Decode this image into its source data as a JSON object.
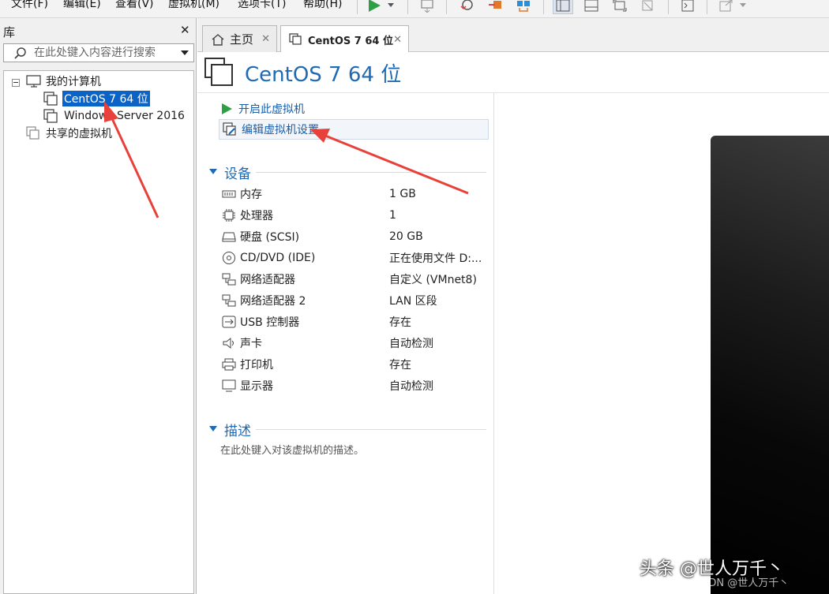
{
  "menu": [
    "文件(F)",
    "编辑(E)",
    "查看(V)",
    "虚拟机(M)",
    "选项卡(T)",
    "帮助(H)"
  ],
  "library": {
    "title": "库",
    "search_placeholder": "在此处键入内容进行搜索",
    "tree": {
      "root": "我的计算机",
      "vms": [
        "CentOS 7 64 位",
        "Windows Server 2016"
      ],
      "shared": "共享的虚拟机"
    }
  },
  "tabs": [
    {
      "label": "主页",
      "active": false
    },
    {
      "label": "CentOS 7 64 位",
      "active": true
    }
  ],
  "vm": {
    "title": "CentOS 7 64 位",
    "actions": [
      "开启此虚拟机",
      "编辑虚拟机设置"
    ],
    "devices_heading": "设备",
    "devices": [
      {
        "name": "内存",
        "value": "1 GB",
        "icon": "memory-icon"
      },
      {
        "name": "处理器",
        "value": "1",
        "icon": "cpu-icon"
      },
      {
        "name": "硬盘 (SCSI)",
        "value": "20 GB",
        "icon": "hard-disk-icon"
      },
      {
        "name": "CD/DVD (IDE)",
        "value": "正在使用文件 D:...",
        "icon": "cd-dvd-icon"
      },
      {
        "name": "网络适配器",
        "value": "自定义 (VMnet8)",
        "icon": "network-adapter-icon"
      },
      {
        "name": "网络适配器 2",
        "value": "LAN 区段",
        "icon": "network-adapter-icon"
      },
      {
        "name": "USB 控制器",
        "value": "存在",
        "icon": "usb-controller-icon"
      },
      {
        "name": "声卡",
        "value": "自动检测",
        "icon": "sound-card-icon"
      },
      {
        "name": "打印机",
        "value": "存在",
        "icon": "printer-icon"
      },
      {
        "name": "显示器",
        "value": "自动检测",
        "icon": "display-icon"
      }
    ],
    "description_heading": "描述",
    "description_placeholder": "在此处键入对该虚拟机的描述。"
  },
  "watermark": {
    "text": "头条 @世人万千丶",
    "sub": "CSDN @世人万千丶"
  },
  "colors": {
    "accent": "#1e6ab4",
    "selection": "#0a64c8",
    "arrow": "#e8403a",
    "play": "#2ea043"
  }
}
